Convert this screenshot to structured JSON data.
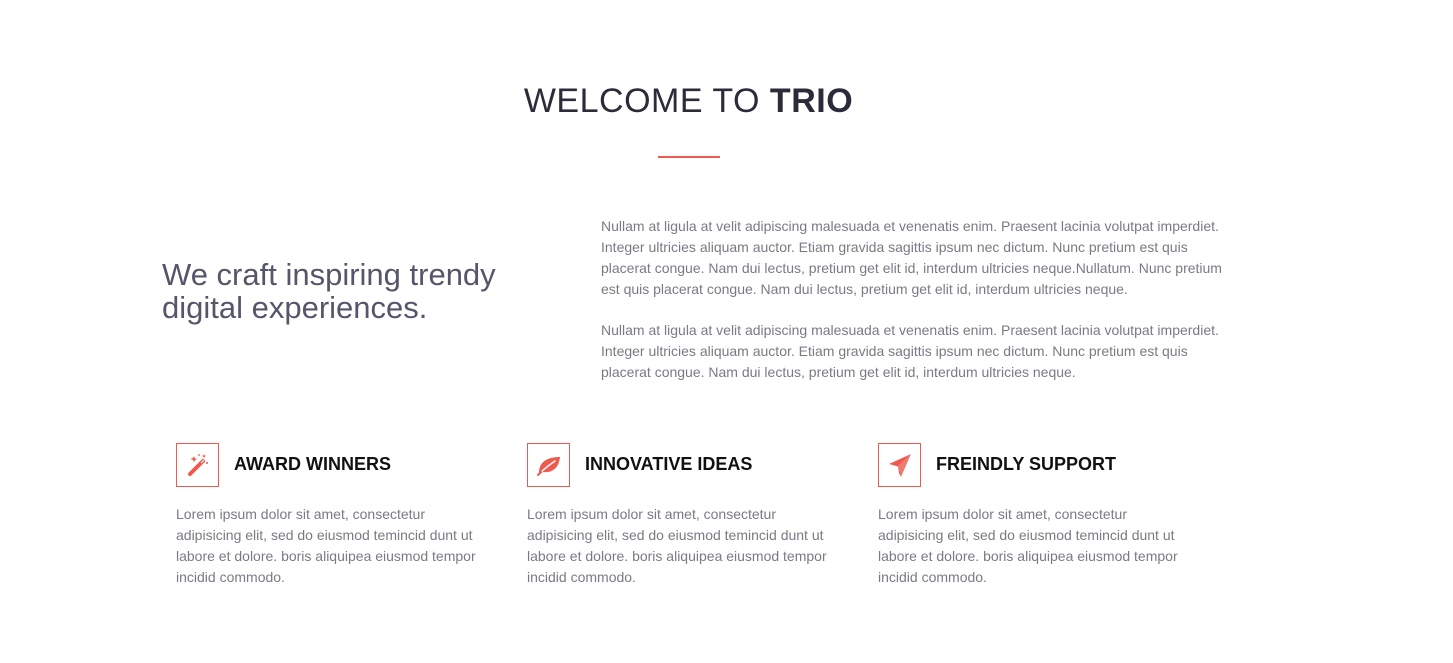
{
  "header": {
    "title_light": "WELCOME TO",
    "title_bold": "TRIO"
  },
  "colors": {
    "accent": "#ee5a4e",
    "heading": "#2b2b3a",
    "body_text": "#7a7a85"
  },
  "about": {
    "tagline": "We craft inspiring trendy digital experiences.",
    "paragraphs": [
      "Nullam at ligula at velit adipiscing malesuada et venenatis enim. Praesent lacinia volutpat imperdiet. Integer ultricies aliquam auctor. Etiam gravida sagittis ipsum nec dictum. Nunc pretium est quis placerat congue. Nam dui lectus, pretium get elit id, interdum ultricies neque.Nullatum. Nunc pretium est quis placerat congue. Nam dui lectus, pretium get elit id, interdum ultricies neque.",
      "Nullam at ligula at velit adipiscing malesuada et venenatis enim. Praesent lacinia volutpat imperdiet. Integer ultricies aliquam auctor. Etiam gravida sagittis ipsum nec dictum. Nunc pretium est quis placerat congue. Nam dui lectus, pretium get elit id, interdum ultricies neque."
    ]
  },
  "features": [
    {
      "icon": "magic-wand-icon",
      "title": "AWARD WINNERS",
      "description": "Lorem ipsum dolor sit amet, consectetur adipisicing elit, sed do eiusmod temincid dunt ut labore et dolore. boris aliquipea eiusmod tempor incidid commodo."
    },
    {
      "icon": "leaf-icon",
      "title": "INNOVATIVE IDEAS",
      "description": "Lorem ipsum dolor sit amet, consectetur adipisicing elit, sed do eiusmod temincid dunt ut labore et dolore. boris aliquipea eiusmod tempor incidid commodo."
    },
    {
      "icon": "paper-plane-icon",
      "title": "FREINDLY SUPPORT",
      "description": "Lorem ipsum dolor sit amet, consectetur adipisicing elit, sed do eiusmod temincid dunt ut labore et dolore. boris aliquipea eiusmod tempor incidid commodo."
    }
  ]
}
